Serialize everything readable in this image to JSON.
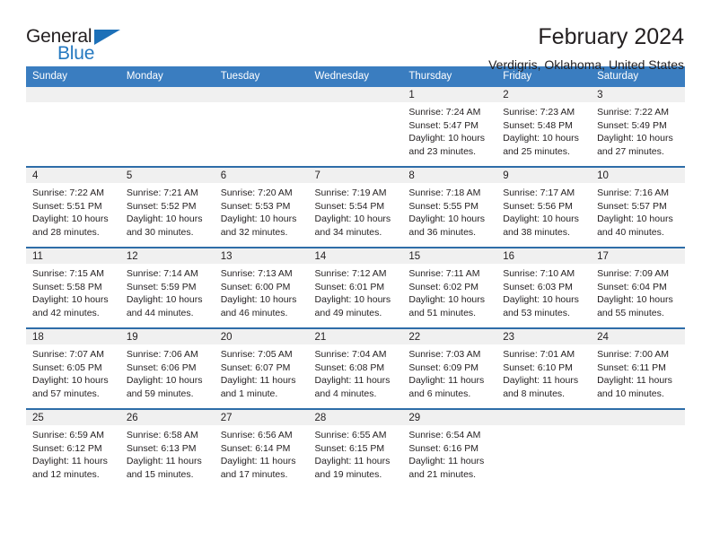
{
  "brand": {
    "name_top": "General",
    "name_bottom": "Blue",
    "accent_color": "#2579c0"
  },
  "header": {
    "title": "February 2024",
    "subtitle": "Verdigris, Oklahoma, United States"
  },
  "theme": {
    "header_blue": "#3a7dc0",
    "row_rule_blue": "#2e6da8",
    "daynum_band": "#f0f0f0",
    "text": "#231f20"
  },
  "calendar": {
    "weekday_headers": [
      "Sunday",
      "Monday",
      "Tuesday",
      "Wednesday",
      "Thursday",
      "Friday",
      "Saturday"
    ],
    "weeks": [
      [
        {
          "day": "",
          "sunrise": "",
          "sunset": "",
          "daylight": ""
        },
        {
          "day": "",
          "sunrise": "",
          "sunset": "",
          "daylight": ""
        },
        {
          "day": "",
          "sunrise": "",
          "sunset": "",
          "daylight": ""
        },
        {
          "day": "",
          "sunrise": "",
          "sunset": "",
          "daylight": ""
        },
        {
          "day": "1",
          "sunrise": "Sunrise: 7:24 AM",
          "sunset": "Sunset: 5:47 PM",
          "daylight": "Daylight: 10 hours and 23 minutes."
        },
        {
          "day": "2",
          "sunrise": "Sunrise: 7:23 AM",
          "sunset": "Sunset: 5:48 PM",
          "daylight": "Daylight: 10 hours and 25 minutes."
        },
        {
          "day": "3",
          "sunrise": "Sunrise: 7:22 AM",
          "sunset": "Sunset: 5:49 PM",
          "daylight": "Daylight: 10 hours and 27 minutes."
        }
      ],
      [
        {
          "day": "4",
          "sunrise": "Sunrise: 7:22 AM",
          "sunset": "Sunset: 5:51 PM",
          "daylight": "Daylight: 10 hours and 28 minutes."
        },
        {
          "day": "5",
          "sunrise": "Sunrise: 7:21 AM",
          "sunset": "Sunset: 5:52 PM",
          "daylight": "Daylight: 10 hours and 30 minutes."
        },
        {
          "day": "6",
          "sunrise": "Sunrise: 7:20 AM",
          "sunset": "Sunset: 5:53 PM",
          "daylight": "Daylight: 10 hours and 32 minutes."
        },
        {
          "day": "7",
          "sunrise": "Sunrise: 7:19 AM",
          "sunset": "Sunset: 5:54 PM",
          "daylight": "Daylight: 10 hours and 34 minutes."
        },
        {
          "day": "8",
          "sunrise": "Sunrise: 7:18 AM",
          "sunset": "Sunset: 5:55 PM",
          "daylight": "Daylight: 10 hours and 36 minutes."
        },
        {
          "day": "9",
          "sunrise": "Sunrise: 7:17 AM",
          "sunset": "Sunset: 5:56 PM",
          "daylight": "Daylight: 10 hours and 38 minutes."
        },
        {
          "day": "10",
          "sunrise": "Sunrise: 7:16 AM",
          "sunset": "Sunset: 5:57 PM",
          "daylight": "Daylight: 10 hours and 40 minutes."
        }
      ],
      [
        {
          "day": "11",
          "sunrise": "Sunrise: 7:15 AM",
          "sunset": "Sunset: 5:58 PM",
          "daylight": "Daylight: 10 hours and 42 minutes."
        },
        {
          "day": "12",
          "sunrise": "Sunrise: 7:14 AM",
          "sunset": "Sunset: 5:59 PM",
          "daylight": "Daylight: 10 hours and 44 minutes."
        },
        {
          "day": "13",
          "sunrise": "Sunrise: 7:13 AM",
          "sunset": "Sunset: 6:00 PM",
          "daylight": "Daylight: 10 hours and 46 minutes."
        },
        {
          "day": "14",
          "sunrise": "Sunrise: 7:12 AM",
          "sunset": "Sunset: 6:01 PM",
          "daylight": "Daylight: 10 hours and 49 minutes."
        },
        {
          "day": "15",
          "sunrise": "Sunrise: 7:11 AM",
          "sunset": "Sunset: 6:02 PM",
          "daylight": "Daylight: 10 hours and 51 minutes."
        },
        {
          "day": "16",
          "sunrise": "Sunrise: 7:10 AM",
          "sunset": "Sunset: 6:03 PM",
          "daylight": "Daylight: 10 hours and 53 minutes."
        },
        {
          "day": "17",
          "sunrise": "Sunrise: 7:09 AM",
          "sunset": "Sunset: 6:04 PM",
          "daylight": "Daylight: 10 hours and 55 minutes."
        }
      ],
      [
        {
          "day": "18",
          "sunrise": "Sunrise: 7:07 AM",
          "sunset": "Sunset: 6:05 PM",
          "daylight": "Daylight: 10 hours and 57 minutes."
        },
        {
          "day": "19",
          "sunrise": "Sunrise: 7:06 AM",
          "sunset": "Sunset: 6:06 PM",
          "daylight": "Daylight: 10 hours and 59 minutes."
        },
        {
          "day": "20",
          "sunrise": "Sunrise: 7:05 AM",
          "sunset": "Sunset: 6:07 PM",
          "daylight": "Daylight: 11 hours and 1 minute."
        },
        {
          "day": "21",
          "sunrise": "Sunrise: 7:04 AM",
          "sunset": "Sunset: 6:08 PM",
          "daylight": "Daylight: 11 hours and 4 minutes."
        },
        {
          "day": "22",
          "sunrise": "Sunrise: 7:03 AM",
          "sunset": "Sunset: 6:09 PM",
          "daylight": "Daylight: 11 hours and 6 minutes."
        },
        {
          "day": "23",
          "sunrise": "Sunrise: 7:01 AM",
          "sunset": "Sunset: 6:10 PM",
          "daylight": "Daylight: 11 hours and 8 minutes."
        },
        {
          "day": "24",
          "sunrise": "Sunrise: 7:00 AM",
          "sunset": "Sunset: 6:11 PM",
          "daylight": "Daylight: 11 hours and 10 minutes."
        }
      ],
      [
        {
          "day": "25",
          "sunrise": "Sunrise: 6:59 AM",
          "sunset": "Sunset: 6:12 PM",
          "daylight": "Daylight: 11 hours and 12 minutes."
        },
        {
          "day": "26",
          "sunrise": "Sunrise: 6:58 AM",
          "sunset": "Sunset: 6:13 PM",
          "daylight": "Daylight: 11 hours and 15 minutes."
        },
        {
          "day": "27",
          "sunrise": "Sunrise: 6:56 AM",
          "sunset": "Sunset: 6:14 PM",
          "daylight": "Daylight: 11 hours and 17 minutes."
        },
        {
          "day": "28",
          "sunrise": "Sunrise: 6:55 AM",
          "sunset": "Sunset: 6:15 PM",
          "daylight": "Daylight: 11 hours and 19 minutes."
        },
        {
          "day": "29",
          "sunrise": "Sunrise: 6:54 AM",
          "sunset": "Sunset: 6:16 PM",
          "daylight": "Daylight: 11 hours and 21 minutes."
        },
        {
          "day": "",
          "sunrise": "",
          "sunset": "",
          "daylight": ""
        },
        {
          "day": "",
          "sunrise": "",
          "sunset": "",
          "daylight": ""
        }
      ]
    ]
  }
}
